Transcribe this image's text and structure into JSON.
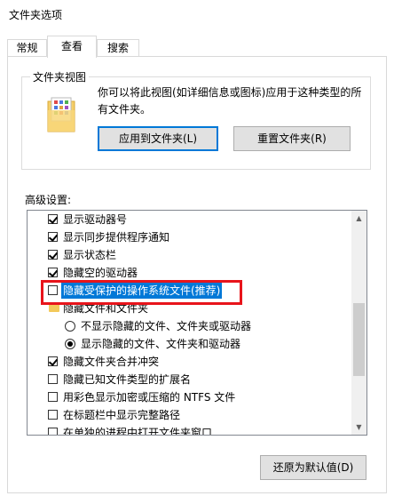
{
  "window": {
    "title": "文件夹选项"
  },
  "tabs": [
    {
      "label": "常规",
      "active": false
    },
    {
      "label": "查看",
      "active": true
    },
    {
      "label": "搜索",
      "active": false
    }
  ],
  "folder_views": {
    "title": "文件夹视图",
    "description": "你可以将此视图(如详细信息或图标)应用于这种类型的所有文件夹。",
    "apply_button": "应用到文件夹(L)",
    "reset_button": "重置文件夹(R)"
  },
  "advanced": {
    "label": "高级设置:",
    "items": [
      {
        "type": "checkbox",
        "checked": true,
        "label": "显示驱动器号"
      },
      {
        "type": "checkbox",
        "checked": true,
        "label": "显示同步提供程序通知"
      },
      {
        "type": "checkbox",
        "checked": true,
        "label": "显示状态栏"
      },
      {
        "type": "checkbox",
        "checked": true,
        "label": "隐藏空的驱动器"
      },
      {
        "type": "checkbox",
        "checked": false,
        "label": "隐藏受保护的操作系统文件(推荐)",
        "selected": true
      },
      {
        "type": "folder",
        "label": "隐藏文件和文件夹"
      },
      {
        "type": "radio",
        "checked": false,
        "label": "不显示隐藏的文件、文件夹或驱动器"
      },
      {
        "type": "radio",
        "checked": true,
        "label": "显示隐藏的文件、文件夹和驱动器"
      },
      {
        "type": "checkbox",
        "checked": true,
        "label": "隐藏文件夹合并冲突"
      },
      {
        "type": "checkbox",
        "checked": false,
        "label": "隐藏已知文件类型的扩展名"
      },
      {
        "type": "checkbox",
        "checked": false,
        "label": "用彩色显示加密或压缩的 NTFS 文件"
      },
      {
        "type": "checkbox",
        "checked": false,
        "label": "在标题栏中显示完整路径"
      },
      {
        "type": "checkbox",
        "checked": false,
        "label": "在单独的进程中打开文件夹窗口"
      }
    ],
    "restore_button": "还原为默认值(D)"
  },
  "colors": {
    "selection": "#0078d7",
    "highlight_box": "#e8141b"
  }
}
